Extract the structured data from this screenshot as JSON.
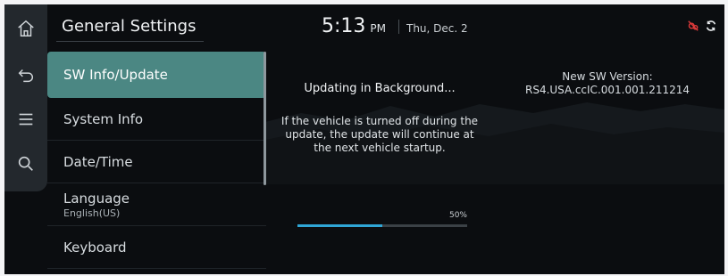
{
  "header": {
    "title": "General Settings"
  },
  "clock": {
    "time": "5:13",
    "ampm": "PM",
    "date": "Thu, Dec. 2"
  },
  "rail": {
    "icons": [
      "home-icon",
      "back-icon",
      "menu-icon",
      "search-icon"
    ]
  },
  "status": {
    "icons": [
      "connectivity-off-icon",
      "sync-icon"
    ],
    "alert_color": "#e03a3a"
  },
  "menu": {
    "items": [
      {
        "label": "SW Info/Update",
        "sub": ""
      },
      {
        "label": "System Info",
        "sub": ""
      },
      {
        "label": "Date/Time",
        "sub": ""
      },
      {
        "label": "Language",
        "sub": "English(US)"
      },
      {
        "label": "Keyboard",
        "sub": ""
      }
    ],
    "active_index": 0,
    "active_color": "#4b8783"
  },
  "update": {
    "title": "Updating in Background...",
    "message": "If the vehicle is turned off during the update, the update will continue at the next vehicle startup.",
    "progress_label": "50%",
    "progress": 0.5,
    "progress_color": "#2fa6d6"
  },
  "software": {
    "label": "New SW Version:",
    "version": "RS4.USA.ccIC.001.001.211214"
  }
}
